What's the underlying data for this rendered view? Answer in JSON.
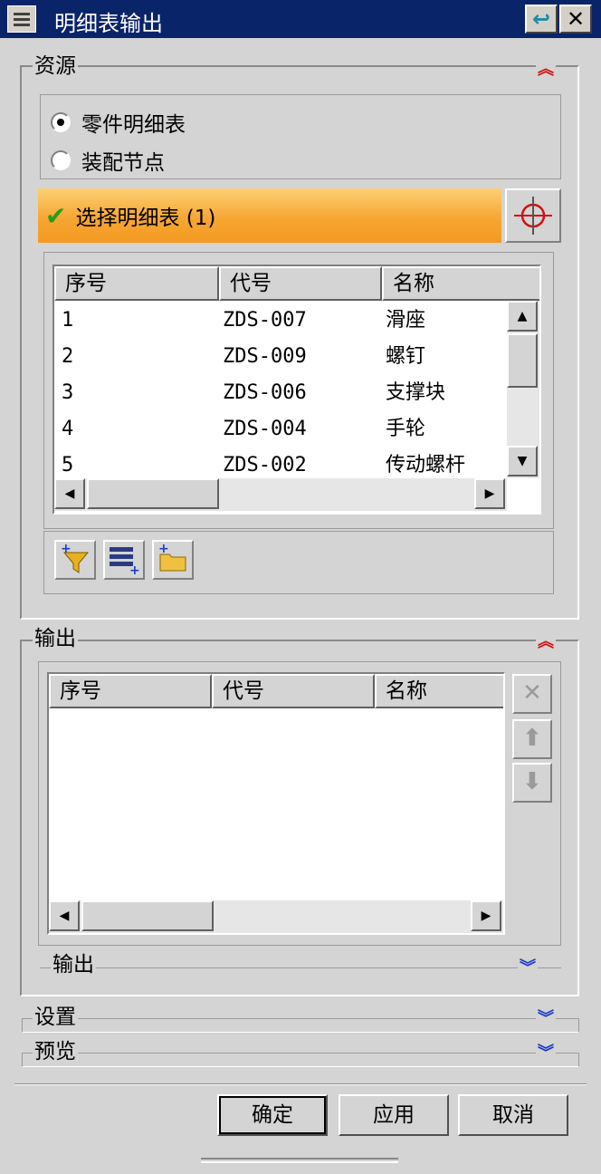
{
  "window": {
    "title": "明细表输出",
    "reset_glyph": "↩",
    "close_glyph": "✕"
  },
  "source": {
    "legend": "资源",
    "radio_options": [
      {
        "label": "零件明细表",
        "checked": true
      },
      {
        "label": "装配节点",
        "checked": false
      }
    ],
    "select_label": "选择明细表 (1)",
    "columns": [
      "序号",
      "代号",
      "名称"
    ],
    "rows": [
      {
        "num": "1",
        "code": "ZDS-007",
        "name": "滑座"
      },
      {
        "num": "2",
        "code": "ZDS-009",
        "name": "螺钉"
      },
      {
        "num": "3",
        "code": "ZDS-006",
        "name": "支撑块"
      },
      {
        "num": "4",
        "code": "ZDS-004",
        "name": "手轮"
      },
      {
        "num": "5",
        "code": "ZDS-002",
        "name": "传动螺杆"
      }
    ],
    "tool_icons": [
      "add-filter-icon",
      "add-list-icon",
      "add-folder-icon"
    ]
  },
  "output": {
    "legend": "输出",
    "columns": [
      "序号",
      "代号",
      "名称"
    ],
    "sub_legend": "输出",
    "side_icons": [
      "delete-icon",
      "move-up-icon",
      "move-down-icon"
    ]
  },
  "settings": {
    "legend": "设置"
  },
  "preview": {
    "legend": "预览"
  },
  "buttons": {
    "ok": "确定",
    "apply": "应用",
    "cancel": "取消"
  },
  "colors": {
    "titlebar": "#0a246a",
    "select_bar": "#f7a633",
    "check": "#2a9c1a",
    "collapse_up": "#d01010",
    "collapse_down": "#1a3cc8"
  }
}
